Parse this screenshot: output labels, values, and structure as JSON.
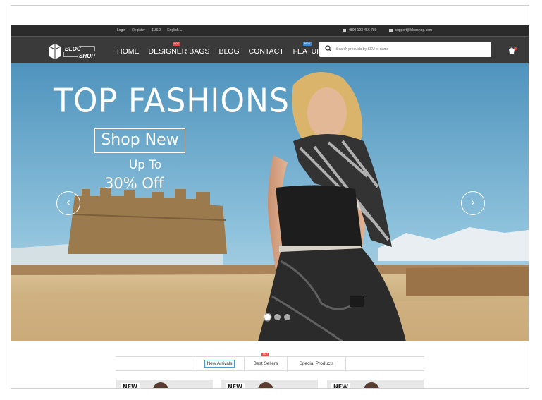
{
  "topbar": {
    "login": "Login",
    "register": "Register",
    "currency": "$USD",
    "language": "English ⌄",
    "phone": "+800 123 456 789",
    "email": "support@blocshop.com"
  },
  "logo": {
    "line1": "BLOC",
    "line2": "SHOP"
  },
  "nav": {
    "items": [
      "HOME",
      "DESIGNER BAGS",
      "BLOG",
      "CONTACT",
      "FEATURES"
    ],
    "hot_badge": "HOT",
    "new_badge": "NEW"
  },
  "search": {
    "placeholder": "Search products by SKU or name"
  },
  "hero": {
    "headline": "TOP FASHIONS",
    "button": "Shop New",
    "upto": "Up To",
    "discount": "30% Off",
    "prev_arrow": "‹",
    "next_arrow": "›",
    "slides": 3,
    "active_slide": 1
  },
  "tabs": {
    "items": [
      "New Arrivals",
      "Best Sellers",
      "Special Products"
    ],
    "active": "New Arrivals",
    "hot_badge": "HOT"
  },
  "products": {
    "badge": "NEW"
  },
  "colors": {
    "topbar": "#2b2b2b",
    "navbar": "#3a3a3a",
    "accent": "#4a9bd1",
    "hot": "#e34c4c",
    "new": "#3b8bd6"
  }
}
